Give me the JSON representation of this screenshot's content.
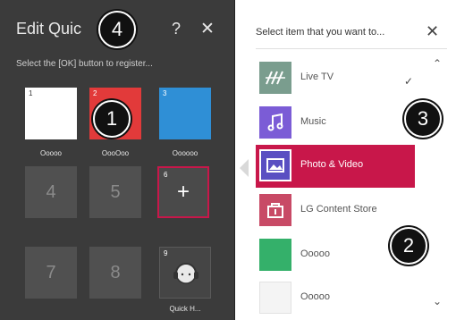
{
  "left_panel": {
    "title": "Edit Quic",
    "help_symbol": "?",
    "close_symbol": "✕",
    "hint": "Select the [OK] button to register...",
    "tiles": [
      {
        "number": "1",
        "label": "Ooooo"
      },
      {
        "number": "2",
        "label": "OooOoo"
      },
      {
        "number": "3",
        "label": "Oooooo"
      }
    ],
    "empty_slots": [
      "4",
      "5",
      "7",
      "8"
    ],
    "add_slot": {
      "number": "6",
      "symbol": "+"
    },
    "quick_help": {
      "number": "9",
      "label": "Quick H..."
    }
  },
  "right_panel": {
    "title": "Select item that you want to...",
    "close_symbol": "✕",
    "chevron_up": "⌃",
    "chevron_down": "⌄",
    "checkmark": "✓",
    "items": [
      {
        "label": "Live TV",
        "thumb_color": "#7a9d8e",
        "icon": "live-tv-icon"
      },
      {
        "label": "Music",
        "thumb_color": "#7b5cd6",
        "icon": "music-icon"
      },
      {
        "label": "Photo & Video",
        "thumb_color": "#5a4fc2",
        "icon": "photo-video-icon",
        "selected": true
      },
      {
        "label": "LG Content Store",
        "thumb_color": "#c84a66",
        "icon": "content-store-icon"
      },
      {
        "label": "Ooooo",
        "thumb_color": "#34b06a",
        "icon": "green-app-icon"
      },
      {
        "label": "Ooooo",
        "thumb_color": "#f4f4f4",
        "icon": "blank-app-icon"
      }
    ]
  },
  "markers": [
    "1",
    "2",
    "3",
    "4"
  ],
  "colors": {
    "panel_bg": "#3b3b3b",
    "accent_red": "#c8174a",
    "tile_blue": "#2f8fd6"
  }
}
